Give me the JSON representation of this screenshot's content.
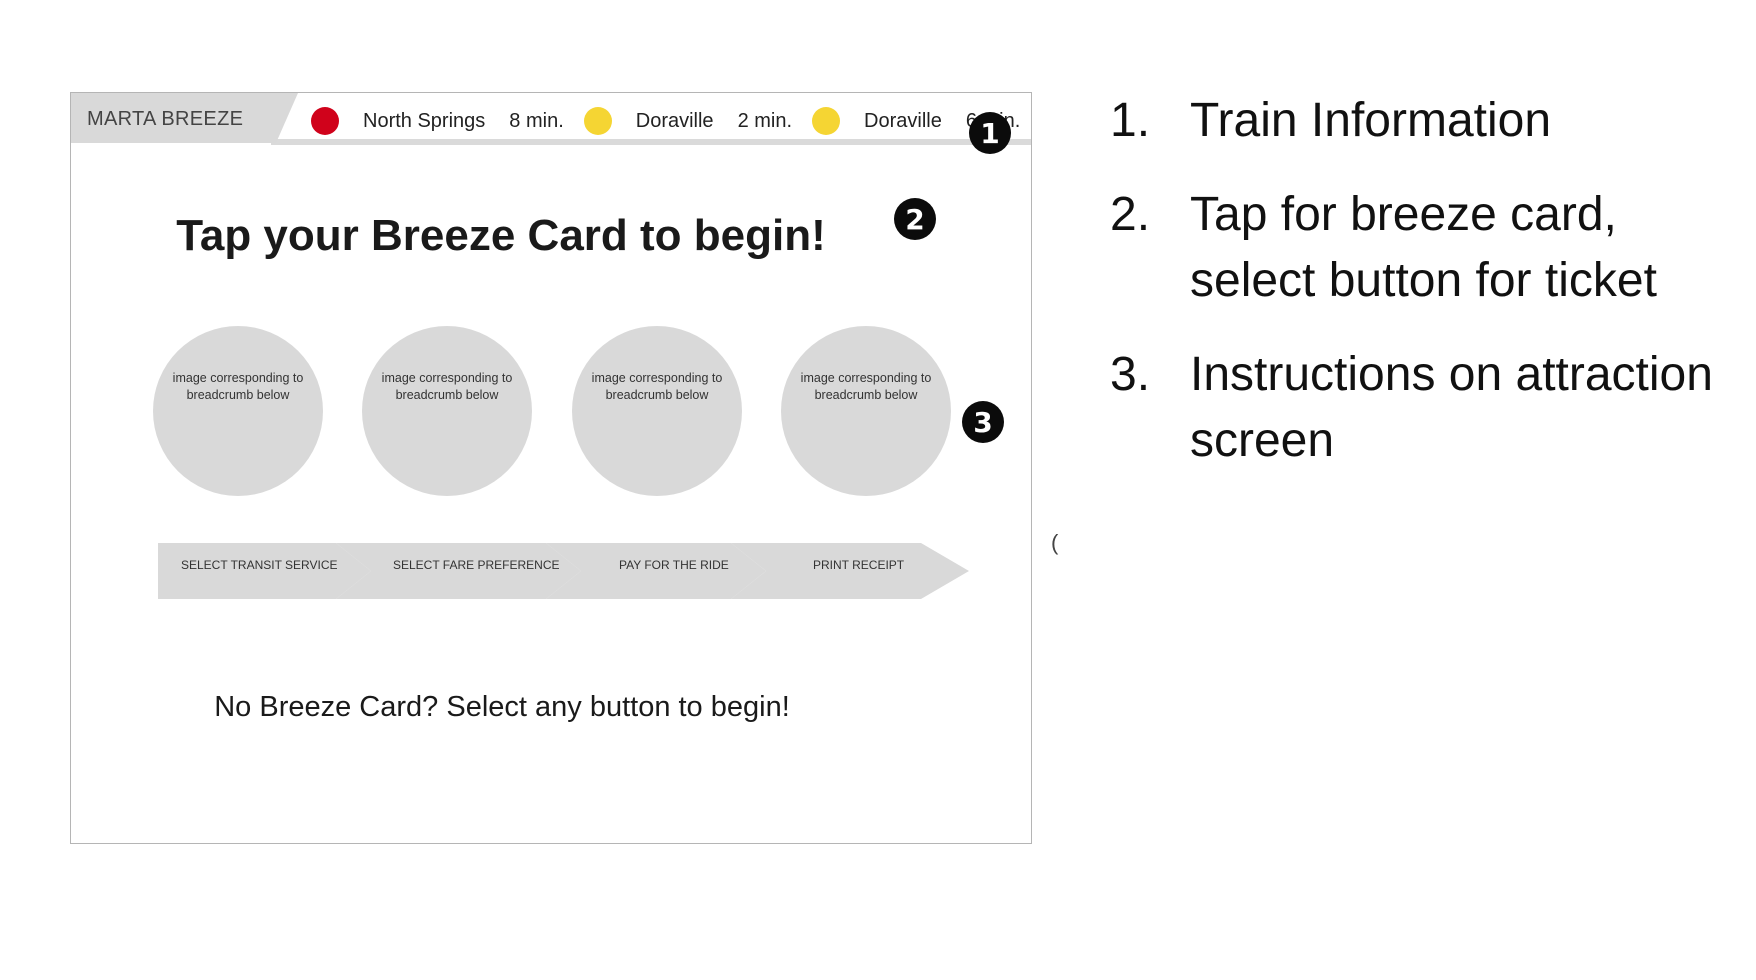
{
  "kiosk": {
    "brand": "MARTA BREEZE",
    "trains": [
      {
        "line_color": "#d0021b",
        "station": "North Springs",
        "eta": "8 min."
      },
      {
        "line_color": "#f5d533",
        "station": "Doraville",
        "eta": "2 min."
      },
      {
        "line_color": "#f5d533",
        "station": "Doraville",
        "eta": "6 min."
      }
    ],
    "headline": "Tap your Breeze Card to begin!",
    "circle_placeholder": "image corresponding to breadcrumb below",
    "breadcrumbs": [
      "SELECT TRANSIT SERVICE",
      "SELECT FARE PREFERENCE",
      "PAY FOR THE RIDE",
      "PRINT RECEIPT"
    ],
    "bottom_text": "No Breeze Card? Select any button to begin!"
  },
  "markers": [
    "1",
    "2",
    "3"
  ],
  "notes": [
    {
      "num": "1.",
      "text": "Train Information"
    },
    {
      "num": "2.",
      "text": "Tap for breeze card, select button for ticket"
    },
    {
      "num": "3.",
      "text": "Instructions on attraction screen"
    }
  ],
  "stray_mark": "(",
  "colors": {
    "panel_gray": "#d9d9d9",
    "red_line": "#d0021b",
    "yellow_line": "#f5d533"
  }
}
